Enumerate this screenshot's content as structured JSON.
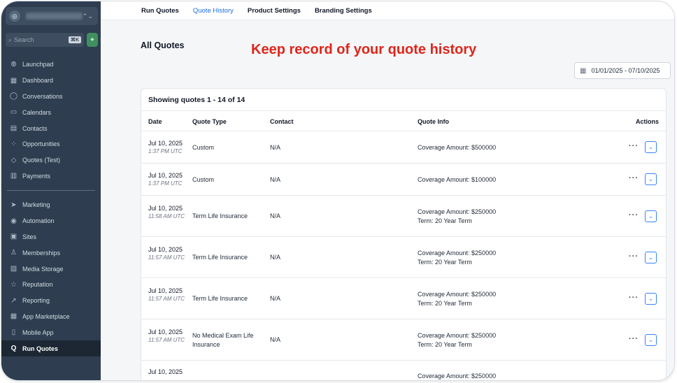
{
  "sidebar": {
    "search_placeholder": "Search",
    "search_shortcut": "⌘K",
    "items_top": [
      {
        "label": "Launchpad",
        "icon": "launchpad-icon",
        "glyph": "⦾"
      },
      {
        "label": "Dashboard",
        "icon": "dashboard-icon",
        "glyph": "▦"
      },
      {
        "label": "Conversations",
        "icon": "chat-bubble-icon",
        "glyph": "◯"
      },
      {
        "label": "Calendars",
        "icon": "calendar-icon",
        "glyph": "▭"
      },
      {
        "label": "Contacts",
        "icon": "contacts-icon",
        "glyph": "▤"
      },
      {
        "label": "Opportunities",
        "icon": "opportunities-icon",
        "glyph": "⁘"
      },
      {
        "label": "Quotes (Test)",
        "icon": "cube-icon",
        "glyph": "◇"
      },
      {
        "label": "Payments",
        "icon": "payments-icon",
        "glyph": "▥"
      }
    ],
    "items_bottom": [
      {
        "label": "Marketing",
        "icon": "send-icon",
        "glyph": "➤"
      },
      {
        "label": "Automation",
        "icon": "automation-icon",
        "glyph": "◉"
      },
      {
        "label": "Sites",
        "icon": "sites-icon",
        "glyph": "▣"
      },
      {
        "label": "Memberships",
        "icon": "membership-icon",
        "glyph": "♙"
      },
      {
        "label": "Media Storage",
        "icon": "media-icon",
        "glyph": "▨"
      },
      {
        "label": "Reputation",
        "icon": "star-icon",
        "glyph": "☆"
      },
      {
        "label": "Reporting",
        "icon": "trend-icon",
        "glyph": "↗"
      },
      {
        "label": "App Marketplace",
        "icon": "apps-icon",
        "glyph": "▦"
      },
      {
        "label": "Mobile App",
        "icon": "mobile-icon",
        "glyph": "▯"
      },
      {
        "label": "Run Quotes",
        "icon": "run-quotes-icon",
        "glyph": "Q",
        "active": true
      }
    ]
  },
  "topnav": {
    "tabs": [
      {
        "label": "Run Quotes",
        "active": false
      },
      {
        "label": "Quote History",
        "active": true
      },
      {
        "label": "Product Settings",
        "active": false
      },
      {
        "label": "Branding Settings",
        "active": false
      }
    ]
  },
  "main": {
    "title": "All Quotes",
    "promo": "Keep record of your quote history",
    "date_range": "01/01/2025 - 07/10/2025",
    "showing": "Showing quotes 1 - 14 of 14",
    "columns": [
      "Date",
      "Quote Type",
      "Contact",
      "Quote Info",
      "Actions"
    ],
    "rows": [
      {
        "date": "Jul 10, 2025",
        "time": "1:37 PM UTC",
        "type": "Custom",
        "contact": "N/A",
        "info1": "Coverage Amount: $500000",
        "info2": ""
      },
      {
        "date": "Jul 10, 2025",
        "time": "1:37 PM UTC",
        "type": "Custom",
        "contact": "N/A",
        "info1": "Coverage Amount: $100000",
        "info2": ""
      },
      {
        "date": "Jul 10, 2025",
        "time": "11:58 AM UTC",
        "type": "Term Life Insurance",
        "contact": "N/A",
        "info1": "Coverage Amount: $250000",
        "info2": "Term: 20 Year Term"
      },
      {
        "date": "Jul 10, 2025",
        "time": "11:57 AM UTC",
        "type": "Term Life Insurance",
        "contact": "N/A",
        "info1": "Coverage Amount: $250000",
        "info2": "Term: 20 Year Term"
      },
      {
        "date": "Jul 10, 2025",
        "time": "11:57 AM UTC",
        "type": "Term Life Insurance",
        "contact": "N/A",
        "info1": "Coverage Amount: $250000",
        "info2": "Term: 20 Year Term"
      },
      {
        "date": "Jul 10, 2025",
        "time": "11:57 AM UTC",
        "type": "No Medical Exam Life Insurance",
        "contact": "N/A",
        "info1": "Coverage Amount: $250000",
        "info2": "Term: 20 Year Term"
      },
      {
        "date": "Jul 10, 2025",
        "time": "",
        "type": "",
        "contact": "",
        "info1": "Coverage Amount: $250000",
        "info2": ""
      }
    ],
    "more_glyph": "···",
    "expand_glyph": "⌄"
  },
  "colors": {
    "sidebar_bg": "#2e3e50",
    "accent": "#1d6fe0",
    "promo": "#e0251b"
  }
}
